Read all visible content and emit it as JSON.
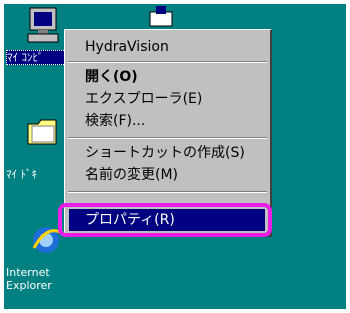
{
  "desktop_icons": [
    {
      "label": "マイ コンピュータ",
      "visible_label": "ﾏｲ ｺﾝﾋﾟ",
      "selected": true
    },
    {
      "label": "マイ ドキュメント",
      "visible_label": "ﾏｲ ﾄﾞｷ"
    },
    {
      "label": "Internet\nExplorer"
    }
  ],
  "context_menu": {
    "items": [
      {
        "label": "HydraVision"
      },
      {
        "label": "開く(O)",
        "bold": true
      },
      {
        "label": "エクスプローラ(E)"
      },
      {
        "label": "検索(F)..."
      },
      {
        "label": "ショートカットの作成(S)"
      },
      {
        "label": "名前の変更(M)"
      },
      {
        "label": "プロパティ(R)",
        "highlighted": true
      }
    ]
  },
  "colors": {
    "desktop": "#008080",
    "menu_bg": "#c0c0c0",
    "highlight": "#000080",
    "annotation_ring": "#e91ee6"
  }
}
